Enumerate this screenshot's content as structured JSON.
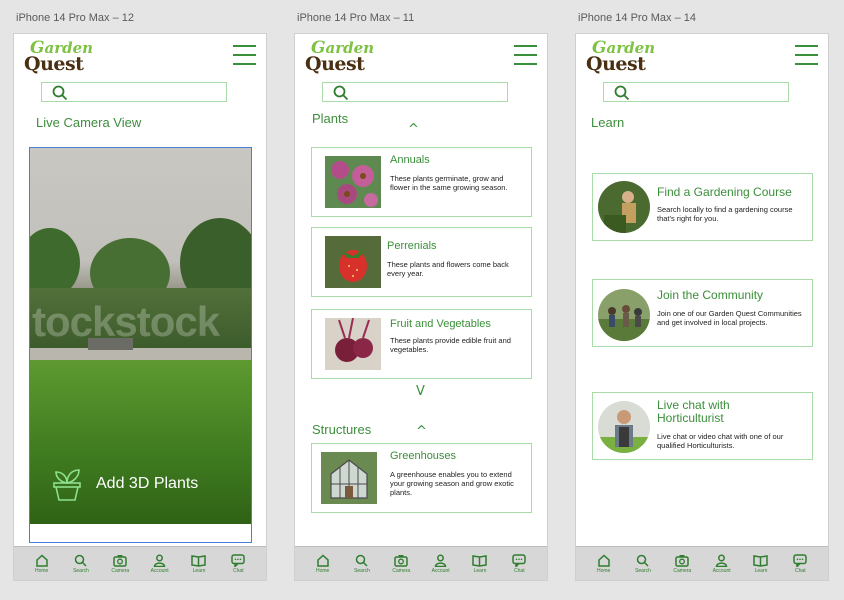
{
  "artboards": [
    {
      "label": "iPhone 14 Pro Max – 12"
    },
    {
      "label": "iPhone 14 Pro Max – 11"
    },
    {
      "label": "iPhone 14 Pro Max – 14"
    }
  ],
  "logo": {
    "top": "arden",
    "bottom": "uest"
  },
  "screen12": {
    "title": "Live Camera View",
    "watermark": "tockstock",
    "add_plants": "Add 3D Plants"
  },
  "screen11": {
    "plants_title": "Plants",
    "structures_title": "Structures",
    "chevron_up": "^",
    "chevron_down": "V",
    "cards": [
      {
        "title": "Annuals",
        "desc": "These plants germinate, grow and flower in the same growing season."
      },
      {
        "title": "Perrenials",
        "desc": "These plants and flowers come back every year."
      },
      {
        "title": "Fruit and Vegetables",
        "desc": "These plants provide edible fruit and vegetables."
      }
    ],
    "structure_cards": [
      {
        "title": "Greenhouses",
        "desc": "A greenhouse enables you to extend your growing season and grow exotic plants."
      }
    ]
  },
  "screen14": {
    "title": "Learn",
    "cards": [
      {
        "title": "Find a Gardening Course",
        "desc": "Search locally to find a gardening course that's right for you."
      },
      {
        "title": "Join the Community",
        "desc": "Join one of our Garden Quest Communities and get involved in local projects."
      },
      {
        "title_line1": "Live chat with",
        "title_line2": "Horticulturist",
        "desc": "Live chat or video chat with one of our qualified Horticulturists."
      }
    ]
  },
  "nav": [
    "Home",
    "Search",
    "Camera",
    "Account",
    "Learn",
    "Chat"
  ],
  "colors": {
    "accent": "#3a8f3a",
    "border": "#a8dba8",
    "logo_brown": "#4a2f12",
    "logo_green": "#7dc242"
  }
}
